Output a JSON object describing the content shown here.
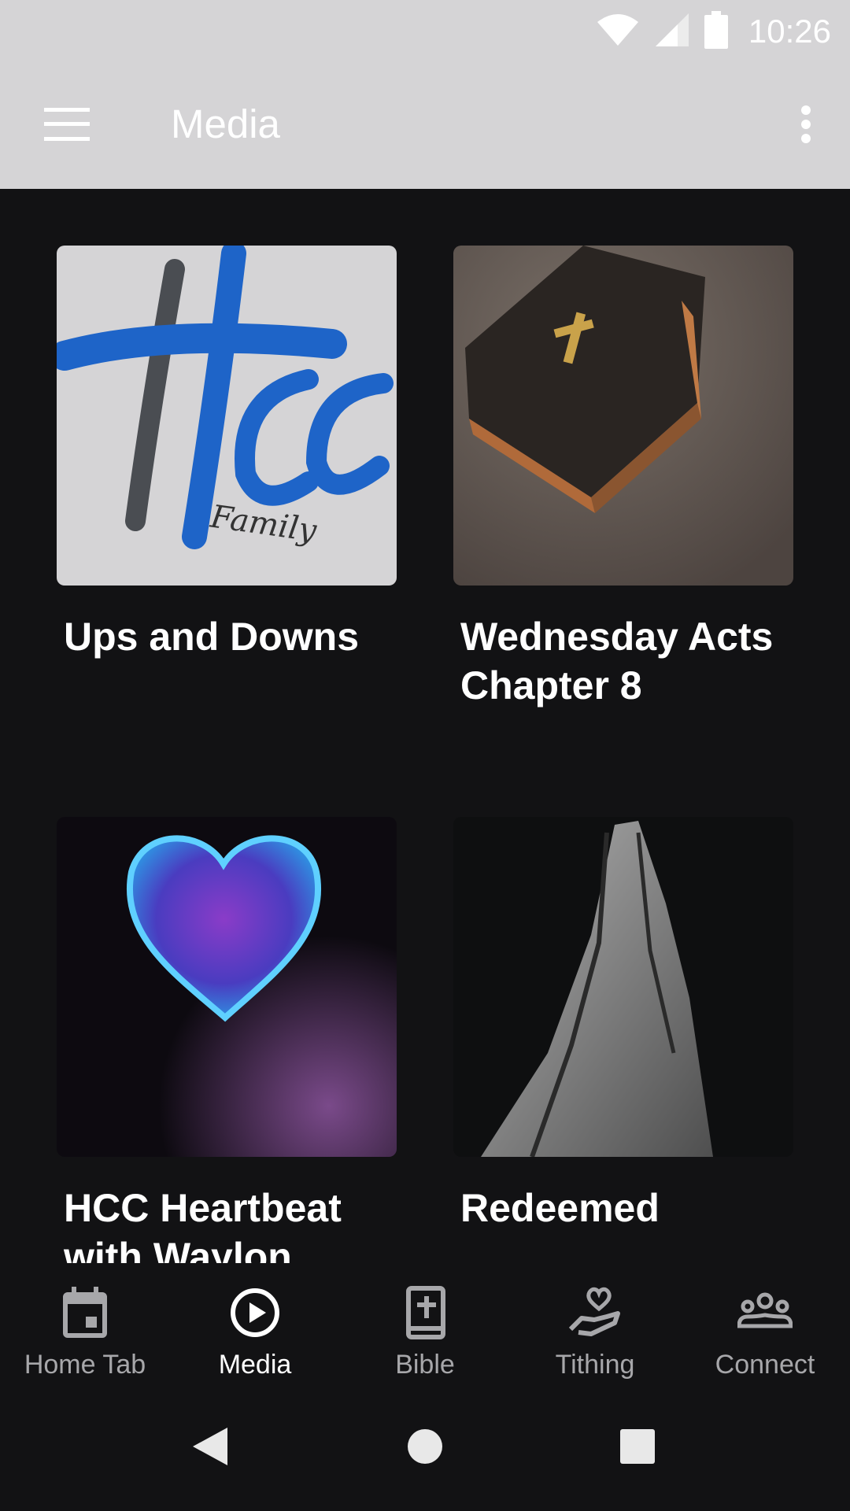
{
  "status": {
    "time": "10:26"
  },
  "app_bar": {
    "title": "Media"
  },
  "media_items": [
    {
      "title": "Ups and Downs",
      "image": "hcc-family-logo",
      "logo_text": "HCC",
      "logo_sub": "Family"
    },
    {
      "title": "Wednesday Acts Chapter 8",
      "image": "bible-book"
    },
    {
      "title": "HCC Heartbeat with Waylon",
      "image": "glass-heart"
    },
    {
      "title": "Redeemed",
      "image": "praying-hands"
    }
  ],
  "bottom_nav": [
    {
      "label": "Home Tab",
      "icon": "calendar-icon",
      "active": false
    },
    {
      "label": "Media",
      "icon": "play-circle-icon",
      "active": true
    },
    {
      "label": "Bible",
      "icon": "bible-icon",
      "active": false
    },
    {
      "label": "Tithing",
      "icon": "heart-hand-icon",
      "active": false
    },
    {
      "label": "Connect",
      "icon": "group-icon",
      "active": false
    }
  ],
  "colors": {
    "app_bar": "#d5d4d6",
    "background": "#121214",
    "nav_inactive": "#a7a7aa",
    "nav_active": "#ffffff",
    "hcc_blue": "#1e64c8"
  }
}
